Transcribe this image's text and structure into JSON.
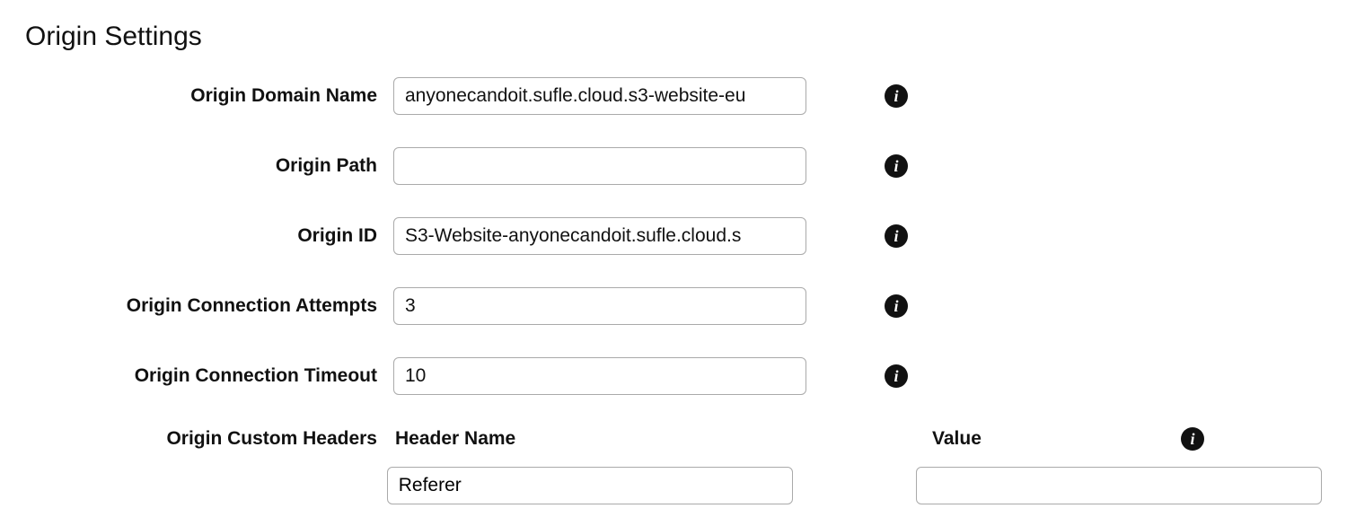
{
  "title": "Origin Settings",
  "fields": {
    "domain_name": {
      "label": "Origin Domain Name",
      "value": "anyonecandoit.sufle.cloud.s3-website-eu"
    },
    "path": {
      "label": "Origin Path",
      "value": ""
    },
    "id": {
      "label": "Origin ID",
      "value": "S3-Website-anyonecandoit.sufle.cloud.s"
    },
    "attempts": {
      "label": "Origin Connection Attempts",
      "value": "3"
    },
    "timeout": {
      "label": "Origin Connection Timeout",
      "value": "10"
    }
  },
  "custom_headers": {
    "label": "Origin Custom Headers",
    "header_name_label": "Header Name",
    "value_label": "Value",
    "rows": [
      {
        "name": "Referer",
        "value": ""
      }
    ]
  },
  "info_glyph": "i"
}
